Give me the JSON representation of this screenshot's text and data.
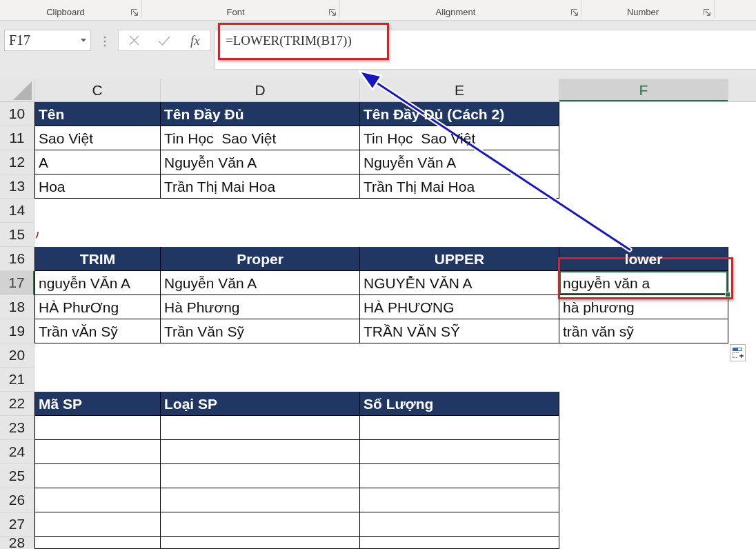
{
  "ribbon": {
    "groups": [
      {
        "label": "Clipboard"
      },
      {
        "label": "Font"
      },
      {
        "label": "Alignment"
      },
      {
        "label": "Number"
      }
    ]
  },
  "formula_bar": {
    "name_box": "F17",
    "buttons": [
      {
        "kind": "cancel",
        "disabled": true
      },
      {
        "kind": "enter",
        "disabled": true
      },
      {
        "kind": "insert_function",
        "label": "fx",
        "disabled": false
      }
    ],
    "formula": "=LOWER(TRIM(B17))",
    "highlighted": true
  },
  "sheet": {
    "columns": [
      {
        "label": "C",
        "selected": false
      },
      {
        "label": "D",
        "selected": false
      },
      {
        "label": "E",
        "selected": false
      },
      {
        "label": "F",
        "selected": true
      }
    ],
    "selection_highlighted": true,
    "rows": [
      {
        "number": "10",
        "selected": false,
        "kind": "header",
        "cells": [
          "Tên",
          "Tên Đầy Đủ",
          "Tên Đầy Đủ (Cách 2)"
        ]
      },
      {
        "number": "11",
        "selected": false,
        "kind": "data",
        "cells": [
          "Sao Việt",
          "Tin Học  Sao Việt",
          "Tin Học  Sao Việt"
        ]
      },
      {
        "number": "12",
        "selected": false,
        "kind": "data",
        "cells": [
          "A",
          "Nguyễn Văn A",
          "Nguyễn Văn A"
        ]
      },
      {
        "number": "13",
        "selected": false,
        "kind": "data",
        "cells": [
          "Hoa",
          "Trần Thị Mai Hoa",
          "Trần Thị Mai Hoa"
        ]
      },
      {
        "number": "14",
        "selected": false,
        "kind": "blank"
      },
      {
        "number": "15",
        "selected": false,
        "kind": "marked"
      },
      {
        "number": "16",
        "selected": false,
        "kind": "centered_header",
        "cells": [
          "TRIM",
          "Proper",
          "UPPER",
          "lower"
        ]
      },
      {
        "number": "17",
        "selected": true,
        "kind": "data",
        "cells": [
          "nguyễn VĂn A",
          "Nguyễn Văn A",
          "NGUYỄN VĂN A",
          "nguyễn văn a"
        ]
      },
      {
        "number": "18",
        "selected": false,
        "kind": "data",
        "cells": [
          "HÀ PhưƠng",
          "Hà Phương",
          "HÀ PHƯƠNG",
          "hà phương"
        ]
      },
      {
        "number": "19",
        "selected": false,
        "kind": "data",
        "cells": [
          "Trần vĂn Sỹ",
          "Trần Văn Sỹ",
          "TRẦN VĂN SỸ",
          "trần văn sỹ"
        ]
      },
      {
        "number": "20",
        "selected": false,
        "kind": "blank"
      },
      {
        "number": "21",
        "selected": false,
        "kind": "blank"
      },
      {
        "number": "22",
        "selected": false,
        "kind": "header",
        "cells": [
          "Mã SP",
          "Loại SP",
          "Số Lượng"
        ]
      },
      {
        "number": "23",
        "selected": false,
        "kind": "empty"
      },
      {
        "number": "24",
        "selected": false,
        "kind": "empty"
      },
      {
        "number": "25",
        "selected": false,
        "kind": "empty"
      },
      {
        "number": "26",
        "selected": false,
        "kind": "empty"
      },
      {
        "number": "27",
        "selected": false,
        "kind": "empty"
      },
      {
        "number": "28",
        "selected": false,
        "kind": "empty"
      }
    ]
  }
}
